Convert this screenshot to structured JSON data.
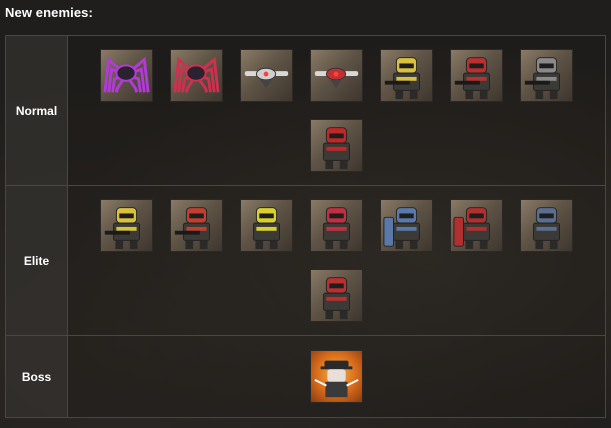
{
  "heading": "New enemies:",
  "rows": [
    {
      "label": "Normal",
      "enemies": [
        {
          "icon": "spider-drone-purple-icon",
          "accent": "#b23ad6"
        },
        {
          "icon": "spider-drone-red-icon",
          "accent": "#d03050"
        },
        {
          "icon": "hover-drone-white-icon",
          "accent": "#cfcfcf"
        },
        {
          "icon": "hover-drone-red-icon",
          "accent": "#c03030"
        },
        {
          "icon": "rifleman-yellow-icon",
          "accent": "#d8c040"
        },
        {
          "icon": "rifleman-red-hood-icon",
          "accent": "#b83030"
        },
        {
          "icon": "rifleman-grey-helmet-icon",
          "accent": "#8a8a8a"
        },
        {
          "icon": "gasmask-soldier-red-icon",
          "accent": "#c02828"
        }
      ]
    },
    {
      "label": "Elite",
      "enemies": [
        {
          "icon": "heavy-gunner-yellow-icon",
          "accent": "#d8c040"
        },
        {
          "icon": "heavy-gunner-red-icon",
          "accent": "#c04030"
        },
        {
          "icon": "mech-trooper-yellow-icon",
          "accent": "#d8d030"
        },
        {
          "icon": "mech-trooper-red-icon",
          "accent": "#c03040"
        },
        {
          "icon": "shield-bearer-blue-icon",
          "accent": "#5a78a8"
        },
        {
          "icon": "shield-bearer-red-icon",
          "accent": "#b03030"
        },
        {
          "icon": "heavy-armor-blue-icon",
          "accent": "#5a6e90"
        },
        {
          "icon": "cat-trooper-red-icon",
          "accent": "#b83030"
        }
      ]
    },
    {
      "label": "Boss",
      "enemies": [
        {
          "icon": "gunslinger-boss-icon",
          "accent": "#f0a040"
        }
      ]
    }
  ]
}
